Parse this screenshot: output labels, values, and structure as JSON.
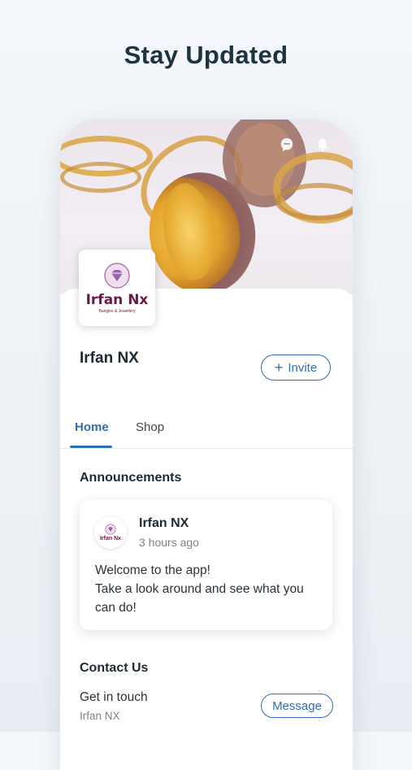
{
  "headline": "Stay Updated",
  "business": {
    "name": "Irfan NX",
    "logo_text": "Irfan Nx",
    "logo_subtitle": "Bangles & Jewellery"
  },
  "actions": {
    "invite_icon": "+",
    "invite_label": "Invite",
    "message_label": "Message"
  },
  "tabs": [
    {
      "label": "Home",
      "active": true
    },
    {
      "label": "Shop",
      "active": false
    }
  ],
  "announcements": {
    "title": "Announcements",
    "post": {
      "author": "Irfan NX",
      "avatar_text": "Irfan Nx",
      "time": "3 hours ago",
      "body_lines": [
        "Welcome to the app!",
        "Take a look around and see what you",
        "can do!"
      ]
    }
  },
  "contact": {
    "title": "Contact Us",
    "line1": "Get in touch",
    "line2": "Irfan NX"
  },
  "icons": {
    "chat": "chat-bubble-icon",
    "bell": "notification-bell-icon",
    "logo": "diamond-icon"
  },
  "colors": {
    "accent": "#2f6fb5",
    "brand": "#6d1847",
    "headline": "#1d3340"
  }
}
